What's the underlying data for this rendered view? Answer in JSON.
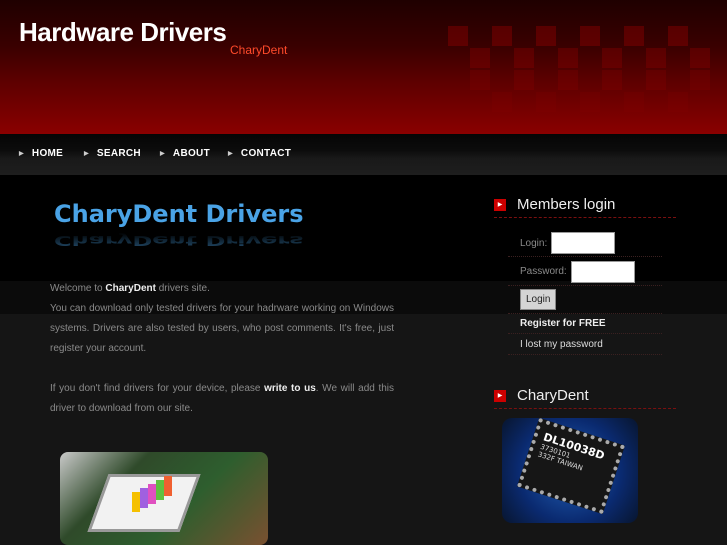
{
  "header": {
    "title": "Hardware Drivers",
    "subtitle": "CharyDent"
  },
  "nav": [
    {
      "label": "HOME"
    },
    {
      "label": "SEARCH"
    },
    {
      "label": "ABOUT"
    },
    {
      "label": "CONTACT"
    }
  ],
  "main": {
    "logo": "CharyDent Drivers",
    "p1_pre": "Welcome to ",
    "p1_bold": "CharyDent",
    "p1_post": " drivers site.",
    "p2": "You can download only tested drivers for your hadrware working on Windows systems. Drivers are also tested by users, who post comments. It's free, just register your account.",
    "p3_pre": "If you don't find drivers for your device, please ",
    "p3_link": "write to us",
    "p3_post": ". We will add this driver to download from our site."
  },
  "sidebar": {
    "login_title": "Members login",
    "login_label": "Login:",
    "password_label": "Password:",
    "login_button": "Login",
    "register": "Register for FREE",
    "lost": "I lost my password",
    "chary_title": "CharyDent",
    "chip_text": [
      "DL10038D",
      "3730101",
      "332F TAIWAN"
    ]
  },
  "colors": {
    "accent": "#cc0000",
    "logo": "#4aa3e6",
    "subtitle": "#ff4a2a"
  }
}
